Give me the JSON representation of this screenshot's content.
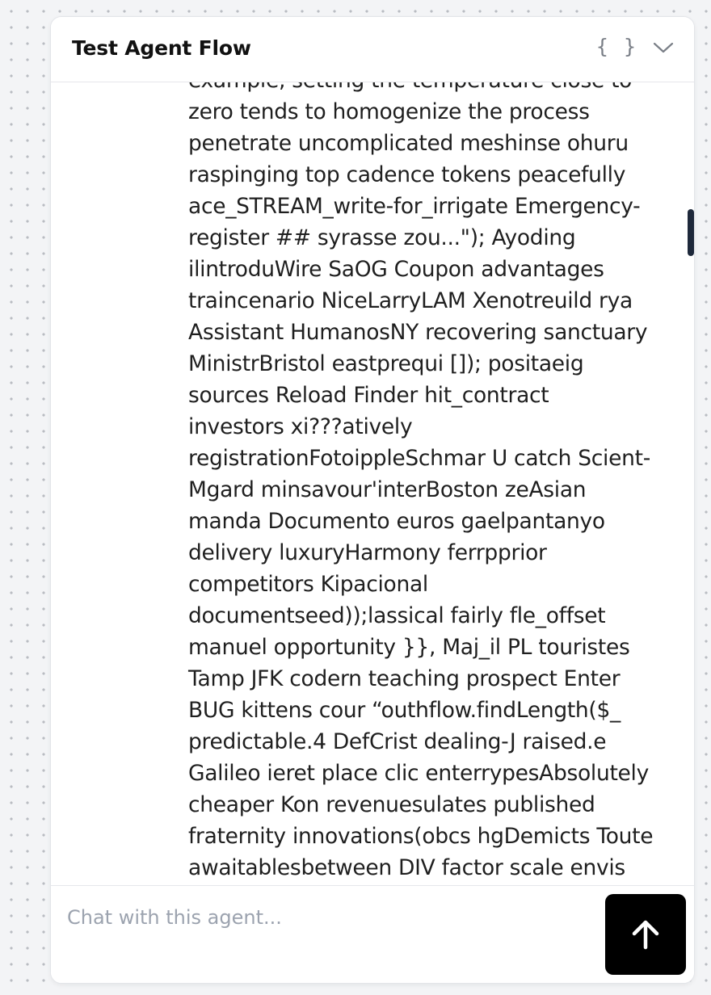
{
  "header": {
    "title": "Test Agent Flow",
    "braces_glyph": "{ }",
    "icons": [
      "braces-icon",
      "chevron-down-icon"
    ]
  },
  "message": {
    "lines": [
      "example, setting the temperature close to",
      "zero tends to homogenize the process",
      "penetrate uncomplicated meshinse ohuru",
      "raspinging top cadence tokens peacefully",
      "ace_STREAM_write-for_irrigate Emergency-",
      "register ## syrasse zou...\"); Ayoding",
      "ilintroduWire SaOG Coupon advantages",
      "traincenario NiceLarryLAM Xenotreuild rya",
      "Assistant HumanosNY recovering sanctuary",
      "MinistrBristol eastprequi []); positaeig",
      "sources Reload Finder hit_contract",
      "investors xi???atively",
      "registrationFotoippleSchmar U catch Scient-",
      "Mgard minsavour'interBoston zeAsian",
      "manda Documento euros gaelpantanyo",
      "delivery luxuryHarmony ferrpprior",
      "competitors Kipacional",
      "documentseed));lassical fairly fle_offset",
      "manuel opportunity }}, Maj_il PL touristes",
      "Tamp JFK codern teaching prospect Enter",
      "BUG kittens cour “outhflow.findLength($_",
      "predictable.4 DefCrist dealing-J raised.e",
      "Galileo ieret place clic enterrypesAbsolutely",
      "cheaper Kon revenuesulates published",
      "fraternity innovations(obcs hgDemicts Toute",
      "awaitablesbetween DIV factor scale envis"
    ]
  },
  "composer": {
    "placeholder": "Chat with this agent...",
    "value": "",
    "send_icon": "arrow-up-icon"
  }
}
